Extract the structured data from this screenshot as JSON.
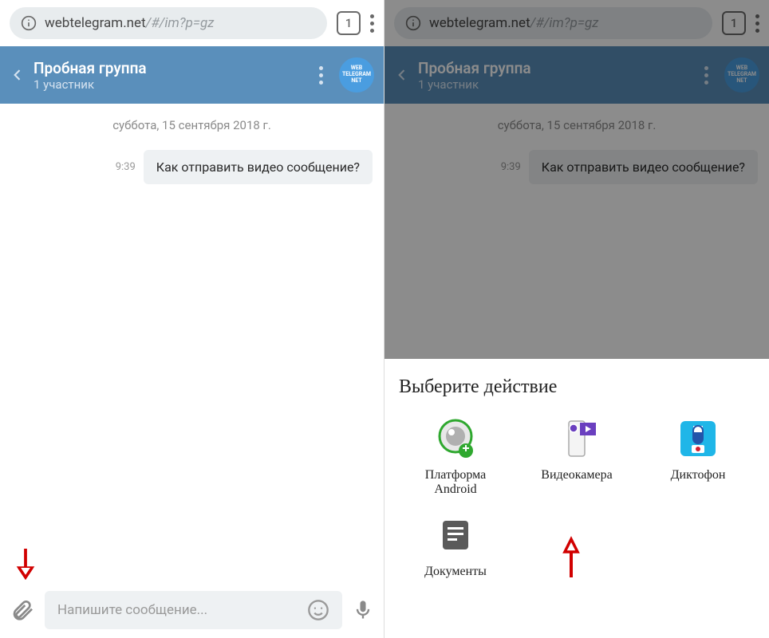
{
  "browser": {
    "url_host": "webtelegram.net",
    "url_rest": "/#/im?p=gz",
    "tab_count": "1"
  },
  "chat": {
    "title": "Пробная группа",
    "subtitle": "1 участник",
    "avatar_text": "WEB TELEGRAM NET",
    "date": "суббота, 15 сентября 2018 г.",
    "msg_time": "9:39",
    "msg_text": "Как отправить видео сообщение?"
  },
  "input": {
    "placeholder": "Напишите сообщение..."
  },
  "sheet": {
    "title": "Выберите действие",
    "items": [
      {
        "label": "Платформа\nAndroid"
      },
      {
        "label": "Видеокамера"
      },
      {
        "label": "Диктофон"
      },
      {
        "label": "Документы"
      }
    ]
  }
}
